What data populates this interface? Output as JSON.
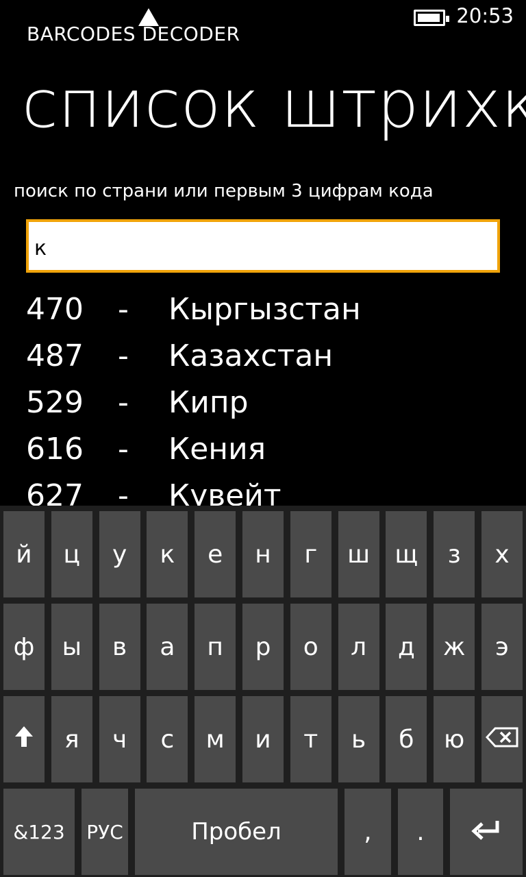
{
  "status": {
    "time": "20:53",
    "battery_level": 0.95
  },
  "app": {
    "title": "BARCODES DECODER",
    "page_title": "список штрихк"
  },
  "search": {
    "label": "поиск по страни или первым 3 цифрам кода",
    "value": "к"
  },
  "results": [
    {
      "code": "470",
      "dash": "-",
      "country": "Кыргызстан"
    },
    {
      "code": "487",
      "dash": "-",
      "country": "Казахстан"
    },
    {
      "code": "529",
      "dash": "-",
      "country": "Кипр"
    },
    {
      "code": "616",
      "dash": "-",
      "country": "Кения"
    },
    {
      "code": "627",
      "dash": "-",
      "country": "Кувейт"
    }
  ],
  "keyboard": {
    "row1": [
      "й",
      "ц",
      "у",
      "к",
      "е",
      "н",
      "г",
      "ш",
      "щ",
      "з",
      "х"
    ],
    "row2": [
      "ф",
      "ы",
      "в",
      "а",
      "п",
      "р",
      "о",
      "л",
      "д",
      "ж",
      "э"
    ],
    "row3": [
      "я",
      "ч",
      "с",
      "м",
      "и",
      "т",
      "ь",
      "б",
      "ю"
    ],
    "shift_icon": "shift-arrow-icon",
    "backspace_icon": "backspace-icon",
    "symbols_label": "&123",
    "lang_label": "РУС",
    "space_label": "Пробел",
    "comma_label": ",",
    "period_label": ".",
    "enter_icon": "enter-icon"
  },
  "colors": {
    "accent": "#f0a30a",
    "key": "#4a4a4a",
    "keyboard_bg": "#1f1f1f",
    "background": "#000000"
  }
}
